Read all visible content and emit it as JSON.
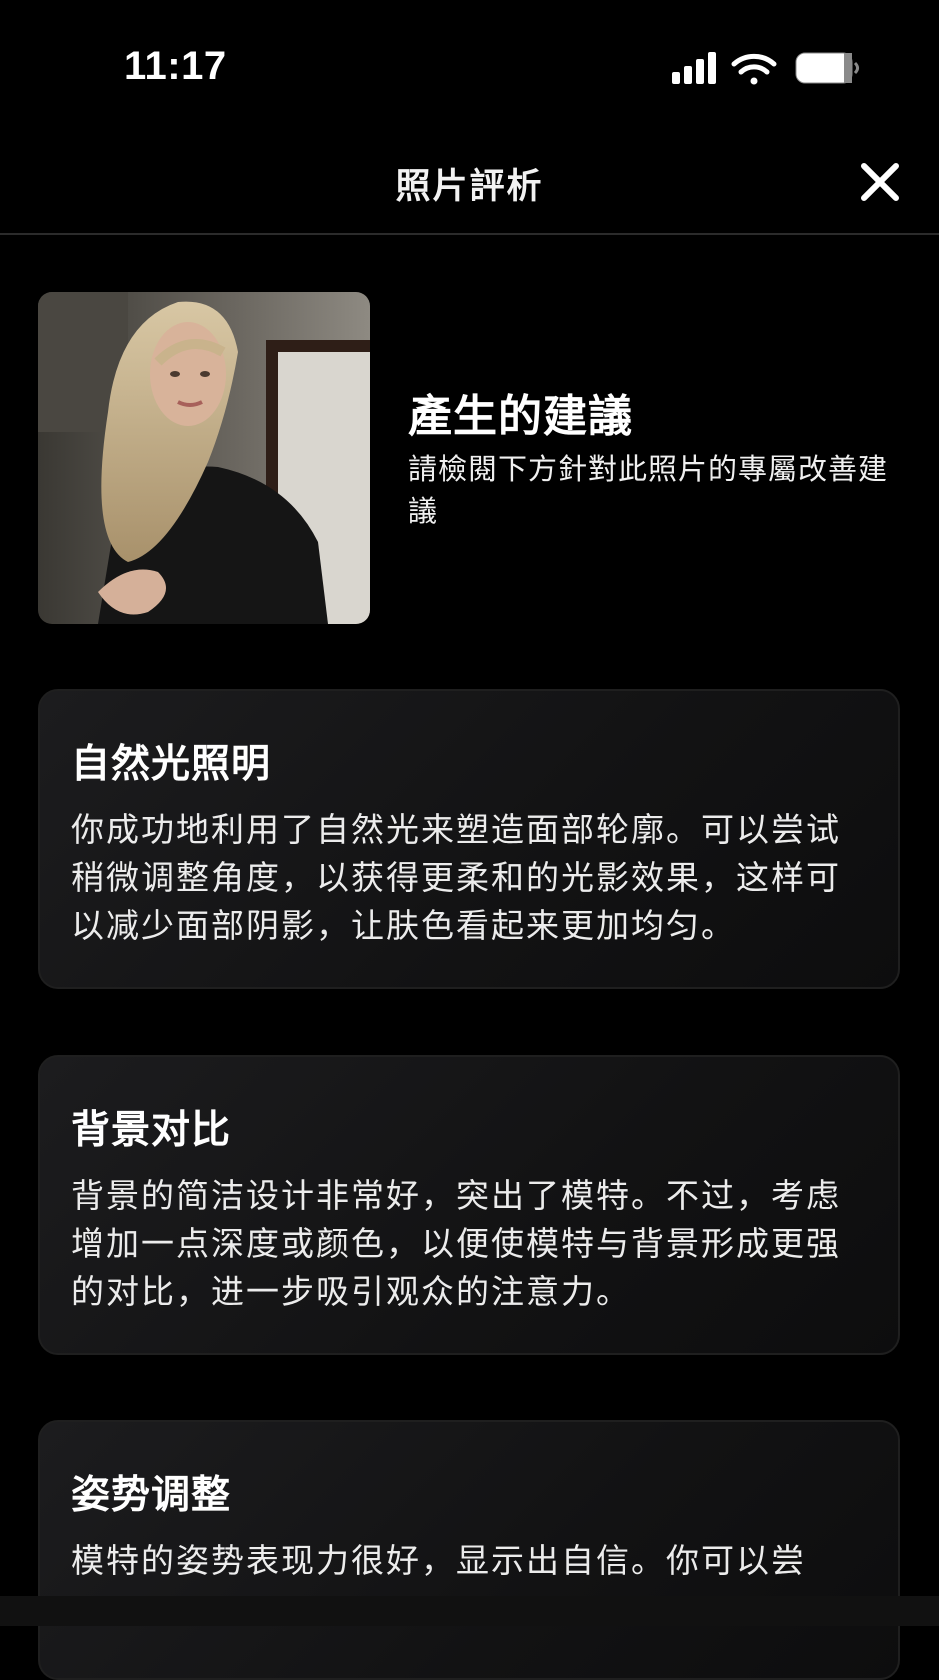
{
  "status_bar": {
    "time": "11:17",
    "icons": [
      "signal-icon",
      "wifi-icon",
      "battery-icon"
    ]
  },
  "nav": {
    "title": "照片評析",
    "close_icon": "close-icon"
  },
  "summary": {
    "title": "產生的建議",
    "description": "請檢閱下方針對此照片的專屬改善建議"
  },
  "suggestions": [
    {
      "title": "自然光照明",
      "body": "你成功地利用了自然光来塑造面部轮廓。可以尝试稍微调整角度，以获得更柔和的光影效果，这样可以减少面部阴影，让肤色看起来更加均匀。"
    },
    {
      "title": "背景对比",
      "body": "背景的简洁设计非常好，突出了模特。不过，考虑增加一点深度或颜色，以便使模特与背景形成更强的对比，进一步吸引观众的注意力。"
    },
    {
      "title": "姿势调整",
      "body": "模特的姿势表现力很好，显示出自信。你可以尝"
    }
  ],
  "colors": {
    "background": "#000000",
    "card": "#161617",
    "text": "#ffffff"
  }
}
